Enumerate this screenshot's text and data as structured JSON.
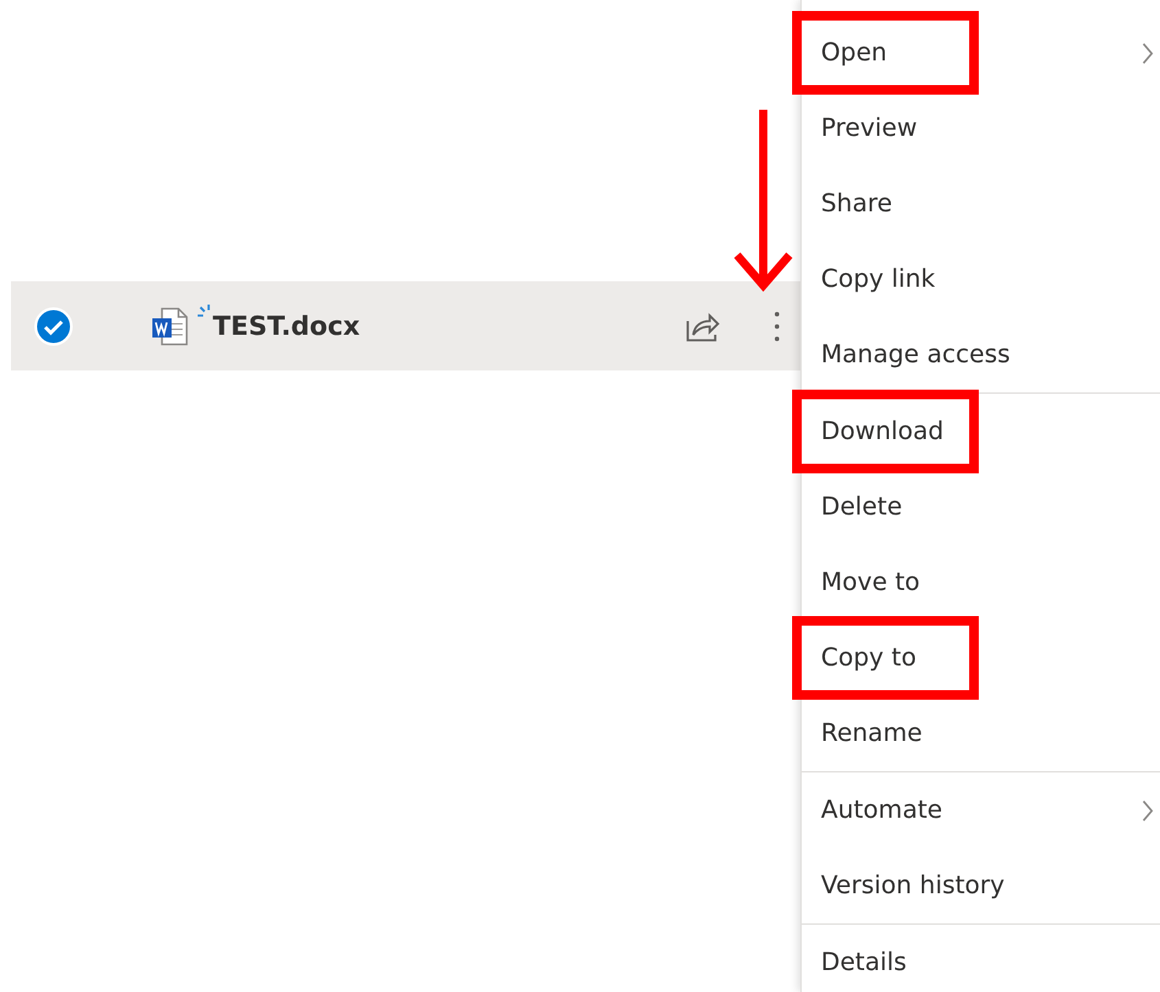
{
  "file_row": {
    "name": "TEST.docx",
    "selected": true,
    "recently_changed": true
  },
  "context_menu": {
    "groups": [
      {
        "items": [
          {
            "label": "Open",
            "submenu": true,
            "highlighted": true
          },
          {
            "label": "Preview",
            "submenu": false,
            "highlighted": false
          },
          {
            "label": "Share",
            "submenu": false,
            "highlighted": false
          },
          {
            "label": "Copy link",
            "submenu": false,
            "highlighted": false
          },
          {
            "label": "Manage access",
            "submenu": false,
            "highlighted": false
          }
        ]
      },
      {
        "items": [
          {
            "label": "Download",
            "submenu": false,
            "highlighted": true
          },
          {
            "label": "Delete",
            "submenu": false,
            "highlighted": false
          },
          {
            "label": "Move to",
            "submenu": false,
            "highlighted": false
          },
          {
            "label": "Copy to",
            "submenu": false,
            "highlighted": true
          },
          {
            "label": "Rename",
            "submenu": false,
            "highlighted": false
          }
        ]
      },
      {
        "items": [
          {
            "label": "Automate",
            "submenu": true,
            "highlighted": false
          },
          {
            "label": "Version history",
            "submenu": false,
            "highlighted": false
          }
        ]
      },
      {
        "items": [
          {
            "label": "Details",
            "submenu": false,
            "highlighted": false
          }
        ]
      }
    ]
  }
}
